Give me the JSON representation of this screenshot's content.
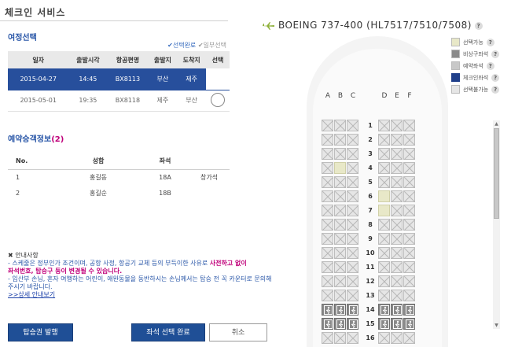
{
  "page": {
    "title": "체크인 서비스"
  },
  "itinerary": {
    "title": "여정선택",
    "legend_selected": "✔선택완료",
    "legend_partial": "✔일부선택",
    "headers": [
      "일자",
      "출발시각",
      "항공편명",
      "출발지",
      "도착지",
      "선택"
    ],
    "rows": [
      {
        "date": "2015-04-27",
        "time": "14:45",
        "flight": "BX8113",
        "from": "부산",
        "to": "제주",
        "selected": true
      },
      {
        "date": "2015-05-01",
        "time": "19:35",
        "flight": "BX8118",
        "from": "제주",
        "to": "부산",
        "selected": false
      }
    ]
  },
  "passengers": {
    "title": "예약승객정보",
    "count": "(2)",
    "headers": {
      "no": "No.",
      "name": "성함",
      "seat": "좌석"
    },
    "rows": [
      {
        "no": "1",
        "name": "홍길동",
        "seat": "18A",
        "note": "창가석"
      },
      {
        "no": "2",
        "name": "홍길순",
        "seat": "18B",
        "note": ""
      }
    ]
  },
  "notice": {
    "head": "✖ 안내사항",
    "line1": "- 스케줄은 정부인가 조건이며, 공항 사정, 항공기 교체 등의 부득이한 사유로",
    "line1_emph": "사전하고 없이",
    "line2_emph": "좌석번호, 탑승구 등이 변경될 수 있습니다.",
    "line3": "- 임산부 손님, 혼자 여행하는 어린이, 애완동물을 동반하시는 손님께서는 탑승 전 꼭 카운터로 문의해주시기 바랍니다.",
    "link": ">>상세 안내보기"
  },
  "buttons": {
    "boarding_pass": "탑승권 발행",
    "seat_confirm": "좌석 선택 완료",
    "cancel": "취소"
  },
  "aircraft": {
    "title": "BOEING 737-400 (HL7517/7510/7508)",
    "help": "?"
  },
  "seat_legend": [
    {
      "label": "선택가능",
      "color": "#e8e8c8",
      "help": "?"
    },
    {
      "label": "비상구좌석",
      "color": "#8a8a8a",
      "help": "?"
    },
    {
      "label": "예약좌석",
      "color": "#c8c8c8",
      "help": "?"
    },
    {
      "label": "체크인좌석",
      "color": "#1f3f8a",
      "help": "?"
    },
    {
      "label": "선택불가능",
      "color": "#e6e6e6",
      "help": "?"
    }
  ],
  "seat_map": {
    "columns": [
      "A",
      "B",
      "C",
      "D",
      "E",
      "F"
    ],
    "rows": [
      {
        "row": "1",
        "seats": [
          "x",
          "x",
          "x",
          "x",
          "x",
          "x"
        ]
      },
      {
        "row": "2",
        "seats": [
          "x",
          "x",
          "x",
          "x",
          "x",
          "x"
        ]
      },
      {
        "row": "3",
        "seats": [
          "x",
          "x",
          "x",
          "x",
          "x",
          "x"
        ]
      },
      {
        "row": "4",
        "seats": [
          "x",
          "o",
          "x",
          "x",
          "x",
          "x"
        ]
      },
      {
        "row": "5",
        "seats": [
          "x",
          "x",
          "x",
          "x",
          "x",
          "x"
        ]
      },
      {
        "row": "6",
        "seats": [
          "x",
          "x",
          "x",
          "o",
          "x",
          "x"
        ]
      },
      {
        "row": "7",
        "seats": [
          "x",
          "x",
          "x",
          "o",
          "x",
          "x"
        ]
      },
      {
        "row": "8",
        "seats": [
          "x",
          "x",
          "x",
          "x",
          "x",
          "x"
        ]
      },
      {
        "row": "9",
        "seats": [
          "x",
          "x",
          "x",
          "x",
          "x",
          "x"
        ]
      },
      {
        "row": "10",
        "seats": [
          "x",
          "x",
          "x",
          "x",
          "x",
          "x"
        ]
      },
      {
        "row": "11",
        "seats": [
          "x",
          "x",
          "x",
          "x",
          "x",
          "x"
        ]
      },
      {
        "row": "12",
        "seats": [
          "x",
          "x",
          "x",
          "x",
          "x",
          "x"
        ]
      },
      {
        "row": "13",
        "seats": [
          "x",
          "x",
          "x",
          "x",
          "x",
          "x"
        ]
      },
      {
        "row": "14",
        "seats": [
          "e",
          "e",
          "e",
          "e",
          "e",
          "e"
        ]
      },
      {
        "row": "15",
        "seats": [
          "e",
          "e",
          "e",
          "e",
          "e",
          "e"
        ]
      },
      {
        "row": "16",
        "seats": [
          "x",
          "x",
          "x",
          "x",
          "x",
          "x"
        ]
      }
    ]
  }
}
